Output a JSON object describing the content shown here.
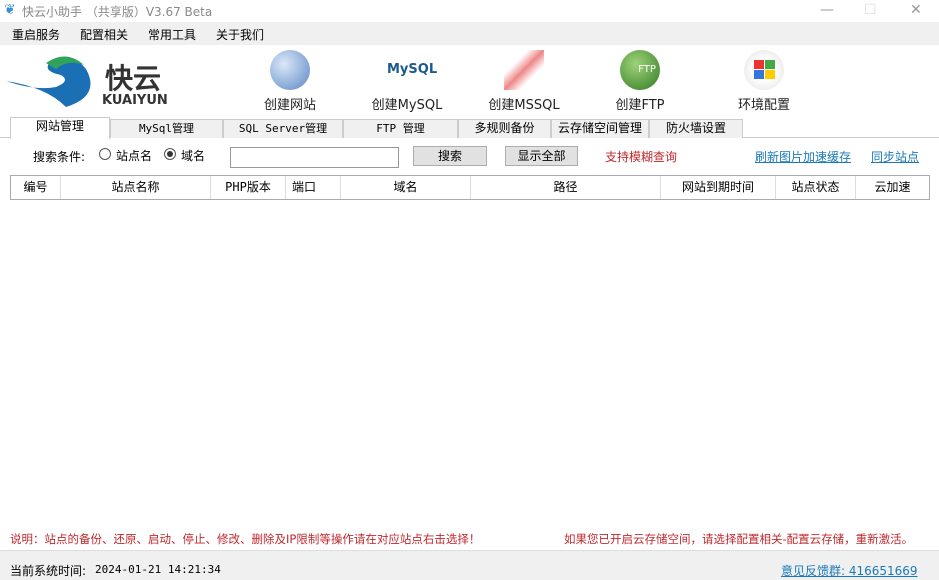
{
  "window": {
    "title": "快云小助手 （共享版）V3.67 Beta",
    "minimize": "—",
    "maximize": "☐",
    "close": "✕"
  },
  "menu": [
    "重启服务",
    "配置相关",
    "常用工具",
    "关于我们"
  ],
  "logo": {
    "cn": "快云",
    "en": "KUAIYUN"
  },
  "toolbar": [
    {
      "label": "创建网站",
      "icon": "globe-icon"
    },
    {
      "label": "创建MySQL",
      "icon": "mysql-icon",
      "icon_text": "MySQL"
    },
    {
      "label": "创建MSSQL",
      "icon": "mssql-icon"
    },
    {
      "label": "创建FTP",
      "icon": "ftp-icon",
      "icon_text": "FTP"
    },
    {
      "label": "环境配置",
      "icon": "windows-icon"
    }
  ],
  "tabs": [
    "网站管理",
    "MySql管理",
    "SQL Server管理",
    "FTP 管理",
    "多规则备份",
    "云存储空间管理",
    "防火墙设置"
  ],
  "search": {
    "label": "搜索条件:",
    "radio_site": "站点名",
    "radio_domain": "域名",
    "selected": "域名",
    "value": "",
    "search_btn": "搜索",
    "show_all_btn": "显示全部",
    "fuzzy_note": "支持模糊查询",
    "refresh_link": "刷新图片加速缓存",
    "sync_link": "同步站点"
  },
  "table": {
    "columns": [
      "编号",
      "站点名称",
      "PHP版本",
      "端口",
      "域名",
      "路径",
      "网站到期时间",
      "站点状态",
      "云加速"
    ],
    "rows": []
  },
  "notes": {
    "left": "说明：站点的备份、还原、启动、停止、修改、删除及IP限制等操作请在对应站点右击选择！",
    "right": "如果您已开启云存储空间，请选择配置相关-配置云存储，重新激活。"
  },
  "status": {
    "time_label": "当前系统时间:",
    "time": "2024-01-21 14:21:34",
    "feedback": "意见反馈群: 416651669"
  },
  "colors": {
    "red": "#c0282d",
    "link": "#1a7ab8"
  }
}
